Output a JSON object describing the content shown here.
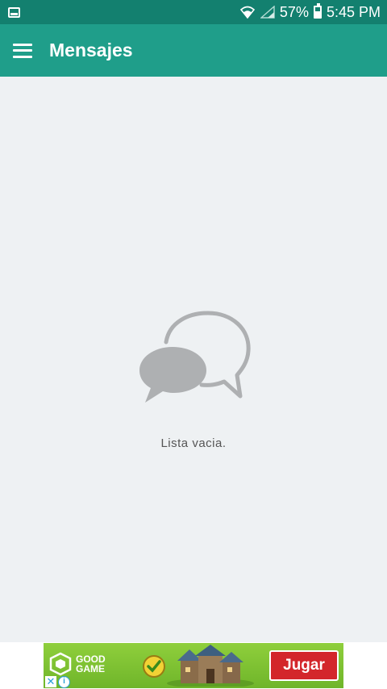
{
  "status_bar": {
    "battery": "57%",
    "time": "5:45 PM"
  },
  "app_bar": {
    "title": "Mensajes"
  },
  "empty_state": {
    "message": "Lista vacia."
  },
  "ad": {
    "brand_line1": "GOOD",
    "brand_line2": "GAME",
    "cta": "Jugar",
    "close_glyph": "✕",
    "info_glyph": "i"
  },
  "colors": {
    "status_bar": "#13806f",
    "app_bar": "#1f9e8a",
    "background": "#eef1f3",
    "icon_gray": "#aeb0b2",
    "ad_green": "#7cc234",
    "ad_button": "#d3262b"
  }
}
